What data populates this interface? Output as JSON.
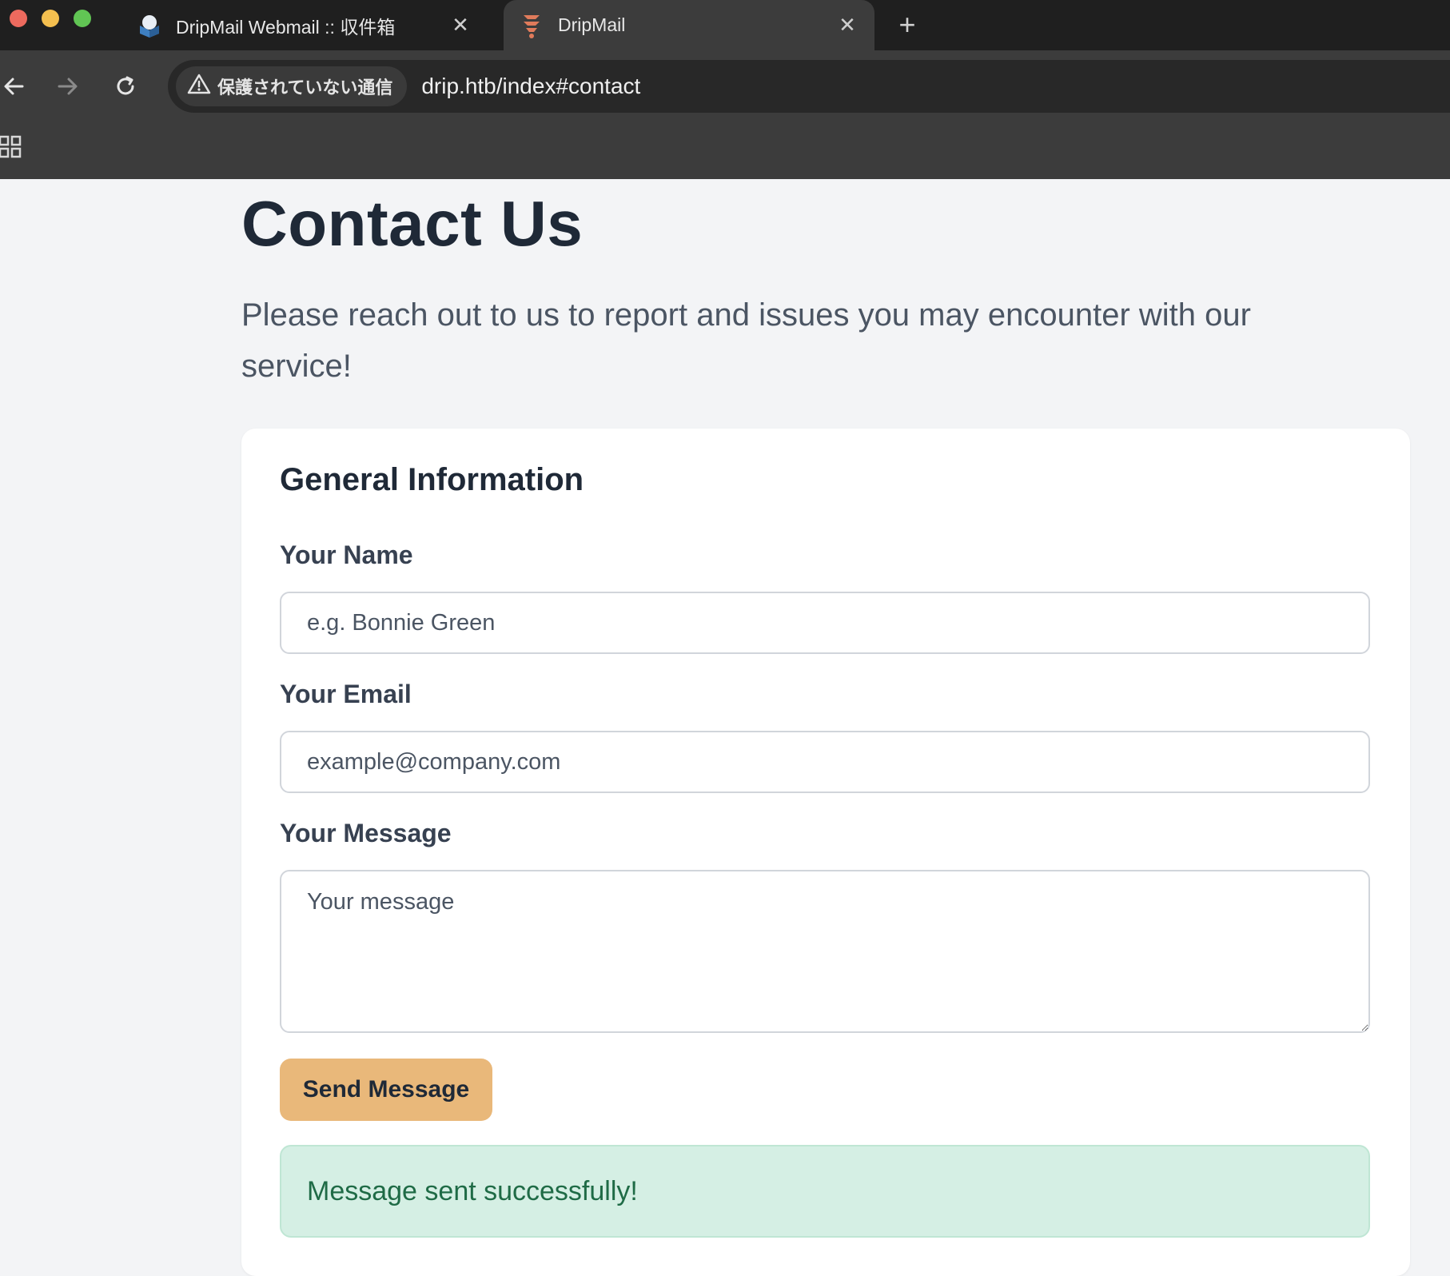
{
  "browser": {
    "tabs": [
      {
        "title": "DripMail Webmail :: 収件箱",
        "active": false,
        "favicon": "roundcube-icon"
      },
      {
        "title": "DripMail",
        "active": true,
        "favicon": "drip-logo-icon"
      }
    ],
    "security_chip": "保護されていない通信",
    "url": "drip.htb/index#contact"
  },
  "page": {
    "title": "Contact Us",
    "description": "Please reach out to us to report and issues you may encounter with our service!",
    "form": {
      "heading": "General Information",
      "name_label": "Your Name",
      "name_placeholder": "e.g. Bonnie Green",
      "email_label": "Your Email",
      "email_placeholder": "example@company.com",
      "message_label": "Your Message",
      "message_placeholder": "Your message",
      "submit_label": "Send Message",
      "success_message": "Message sent successfully!"
    }
  },
  "colors": {
    "accent_button": "#e9b87a",
    "success_bg": "#d5efe4",
    "success_text": "#1f6b46"
  }
}
